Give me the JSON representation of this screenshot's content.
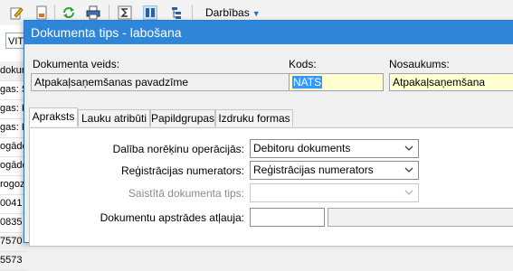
{
  "app": {
    "toolbar_menu_label": "Darbības",
    "left_field_value": "VIT",
    "left_rows": [
      "dokum",
      "gas: S",
      "gas: K",
      "gas: K",
      "ogāde",
      "ogāde",
      "rogoz",
      "0041",
      "0835",
      "7570",
      "5573"
    ]
  },
  "dialog": {
    "title": "Dokumenta tips - labošana",
    "doc_type_label": "Dokumenta veids:",
    "doc_type_value": "Atpakaļsaņemšanas pavadzīme",
    "code_label": "Kods:",
    "code_value": "NATS",
    "name_label": "Nosaukums:",
    "name_value": "Atpakaļsaņemšana",
    "tabs": [
      "Apraksts",
      "Lauku atribūti",
      "Papildgrupas",
      "Izdruku formas"
    ],
    "fields": {
      "settlement_label": "Dalība norēķinu operācijās:",
      "settlement_value": "Debitoru dokuments",
      "numerator_label": "Reģistrācijas numerators:",
      "numerator_value": "Reģistrācijas numerators",
      "linked_label": "Saistītā dokumenta tips:",
      "linked_value": "",
      "permission_label": "Dokumentu apstrādes atļauja:",
      "permission_value": "",
      "permission_name": ""
    }
  }
}
